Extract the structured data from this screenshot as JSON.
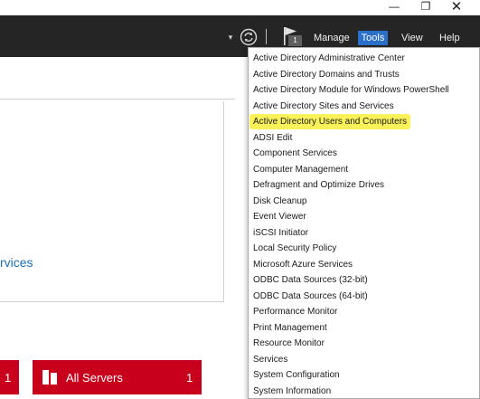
{
  "window": {
    "minimize_glyph": "—",
    "restore_glyph": "❐",
    "close_glyph": "✕"
  },
  "toolbar": {
    "dropdown_glyph": "▾",
    "refresh_icon": "refresh-icon",
    "flag_icon": "flag-icon",
    "notification_count": "1",
    "menu": [
      "Manage",
      "Tools",
      "View",
      "Help"
    ]
  },
  "main": {
    "services_link": "rvices",
    "tiles": [
      {
        "label": "",
        "count": "1"
      },
      {
        "label": "All Servers",
        "count": "1"
      }
    ]
  },
  "tools_menu": {
    "highlight_color": "#fbf25a",
    "items": [
      "Active Directory Administrative Center",
      "Active Directory Domains and Trusts",
      "Active Directory Module for Windows PowerShell",
      "Active Directory Sites and Services",
      "Active Directory Users and Computers",
      "ADSI Edit",
      "Component Services",
      "Computer Management",
      "Defragment and Optimize Drives",
      "Disk Cleanup",
      "Event Viewer",
      "iSCSI Initiator",
      "Local Security Policy",
      "Microsoft Azure Services",
      "ODBC Data Sources (32-bit)",
      "ODBC Data Sources (64-bit)",
      "Performance Monitor",
      "Print Management",
      "Resource Monitor",
      "Services",
      "System Configuration",
      "System Information"
    ]
  },
  "colors": {
    "toolbar_bg": "#252525",
    "tools_active": "#2a6fc9",
    "tile_red": "#c8001b",
    "link_blue": "#1e6fb8"
  }
}
